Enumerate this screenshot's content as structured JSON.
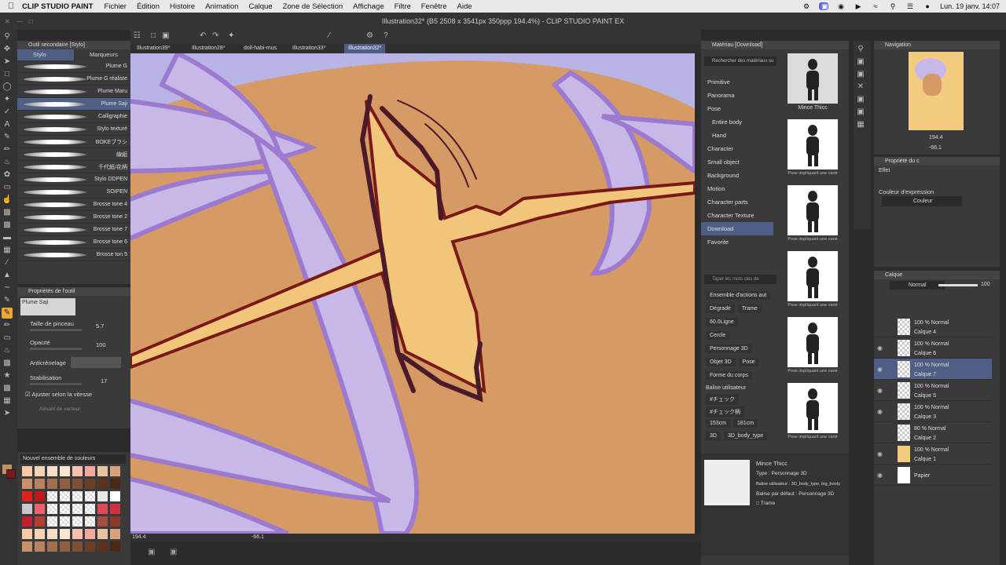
{
  "menubar": {
    "app": "CLIP STUDIO PAINT",
    "items": [
      "Fichier",
      "Édition",
      "Histoire",
      "Animation",
      "Calque",
      "Zone de Sélection",
      "Affichage",
      "Filtre",
      "Fenêtre",
      "Aide"
    ],
    "datetime": "Lun. 19 janv.  14:07"
  },
  "window": {
    "title": "Illustration32* (B5 2508 x 3541px 350ppp 194.4%) - CLIP STUDIO PAINT EX"
  },
  "doc_tabs": [
    "Illustration39*",
    "Illustration28*",
    "doll-habi-mus",
    "Illustration33*",
    "Illustration32*"
  ],
  "sub_tool": {
    "header": "Outil secondaire [Stylo]",
    "tab_stylo": "Stylo",
    "tab_marqueurs": "Marqueurs",
    "brushes": [
      "Plume G",
      "Plume G réaliste",
      "Plume Maru",
      "Plume Saji",
      "Calligraphie",
      "Stylo texturé",
      "BOKEブラシ",
      "線組",
      "千代紙/花柄",
      "Stylo DDPEN",
      "SOIPEN",
      "Brosse tone 4",
      "Brosse tone 2",
      "Brosse tone 7",
      "Brosse tone 6",
      "Brosse ton 5"
    ],
    "selected_index": 3
  },
  "tool_props": {
    "header": "Propriétés de l'outil",
    "preview_name": "Plume Saji",
    "brush_size_label": "Taille de pinceau",
    "brush_size": "5.7",
    "opacity_label": "Opacité",
    "opacity": "100",
    "antialias_label": "Anticrénelage",
    "stabilization_label": "Stabilisation",
    "stabilization": "17",
    "speed_label": "Ajuster selon la vitesse",
    "vector_label": "Aimant de vecteur"
  },
  "color_set": {
    "name": "Nouvel ensemble de couleurs",
    "main_color": "#c4905f",
    "sub_color": "#7a1818"
  },
  "canvas": {
    "zoom": "194.4",
    "angle": "-66.1",
    "bg_color": "#b8b4e6",
    "skin_color": "#d69a64",
    "hair_color": "#c8b8e8"
  },
  "materials": {
    "header": "Matériau [Download]",
    "search_placeholder": "Rechercher des matériaux su",
    "tree": [
      "Primitive",
      "Panorama",
      "Pose",
      "Entire body",
      "Hand",
      "Character",
      "Small object",
      "Background",
      "Motion",
      "Character parts",
      "Character Texture",
      "Download",
      "Favorite"
    ],
    "selected_tree": "Download",
    "tag_search_placeholder": "Taper les mots clés de",
    "tags": [
      "Ensemble d'actions aut",
      "Dégradé",
      "Trame",
      "60.0Ligne",
      "Cercle",
      "Personnage 3D",
      "Objet 3D",
      "Pose",
      "Forme du corps"
    ],
    "user_tags_label": "Balise utilisateur",
    "user_tags": [
      "#チェック",
      "#チェック柄",
      "153cm",
      "181cm",
      "3D",
      "3D_body_type"
    ],
    "thumb_caption_first": "Mince Thicc",
    "thumb_caption_other": "Pose impliquant une varié",
    "detail": {
      "name": "Mince Thicc",
      "type": "Type : Personnage 3D",
      "user_tag": "Balise utilisateur : 3D_body_type, big_booty",
      "default_tag": "Balise par défaut : Personnage 3D",
      "trame": "Trame"
    }
  },
  "navigation": {
    "header": "Navigation",
    "zoom": "194.4",
    "angle": "-66.1"
  },
  "properties": {
    "header": "Propriété du c",
    "effect": "Effet",
    "expr_label": "Couleur d'expression",
    "expr_value": "Couleur"
  },
  "layers": {
    "header": "Calque",
    "blend_mode": "Normal",
    "opacity": "100",
    "rows": [
      {
        "mode": "100 % Normal",
        "name": "Calque 4",
        "visible": false
      },
      {
        "mode": "100 % Normal",
        "name": "Calque 6",
        "visible": true
      },
      {
        "mode": "100 % Normal",
        "name": "Calque 7",
        "visible": true
      },
      {
        "mode": "100 % Normal",
        "name": "Calque 5",
        "visible": true
      },
      {
        "mode": "100 % Normal",
        "name": "Calque 3",
        "visible": true
      },
      {
        "mode": "80 % Normal",
        "name": "Calque 2",
        "visible": false
      },
      {
        "mode": "100 % Normal",
        "name": "Calque 1",
        "visible": true
      },
      {
        "mode": "",
        "name": "Papier",
        "visible": true
      }
    ],
    "selected_index": 2
  }
}
